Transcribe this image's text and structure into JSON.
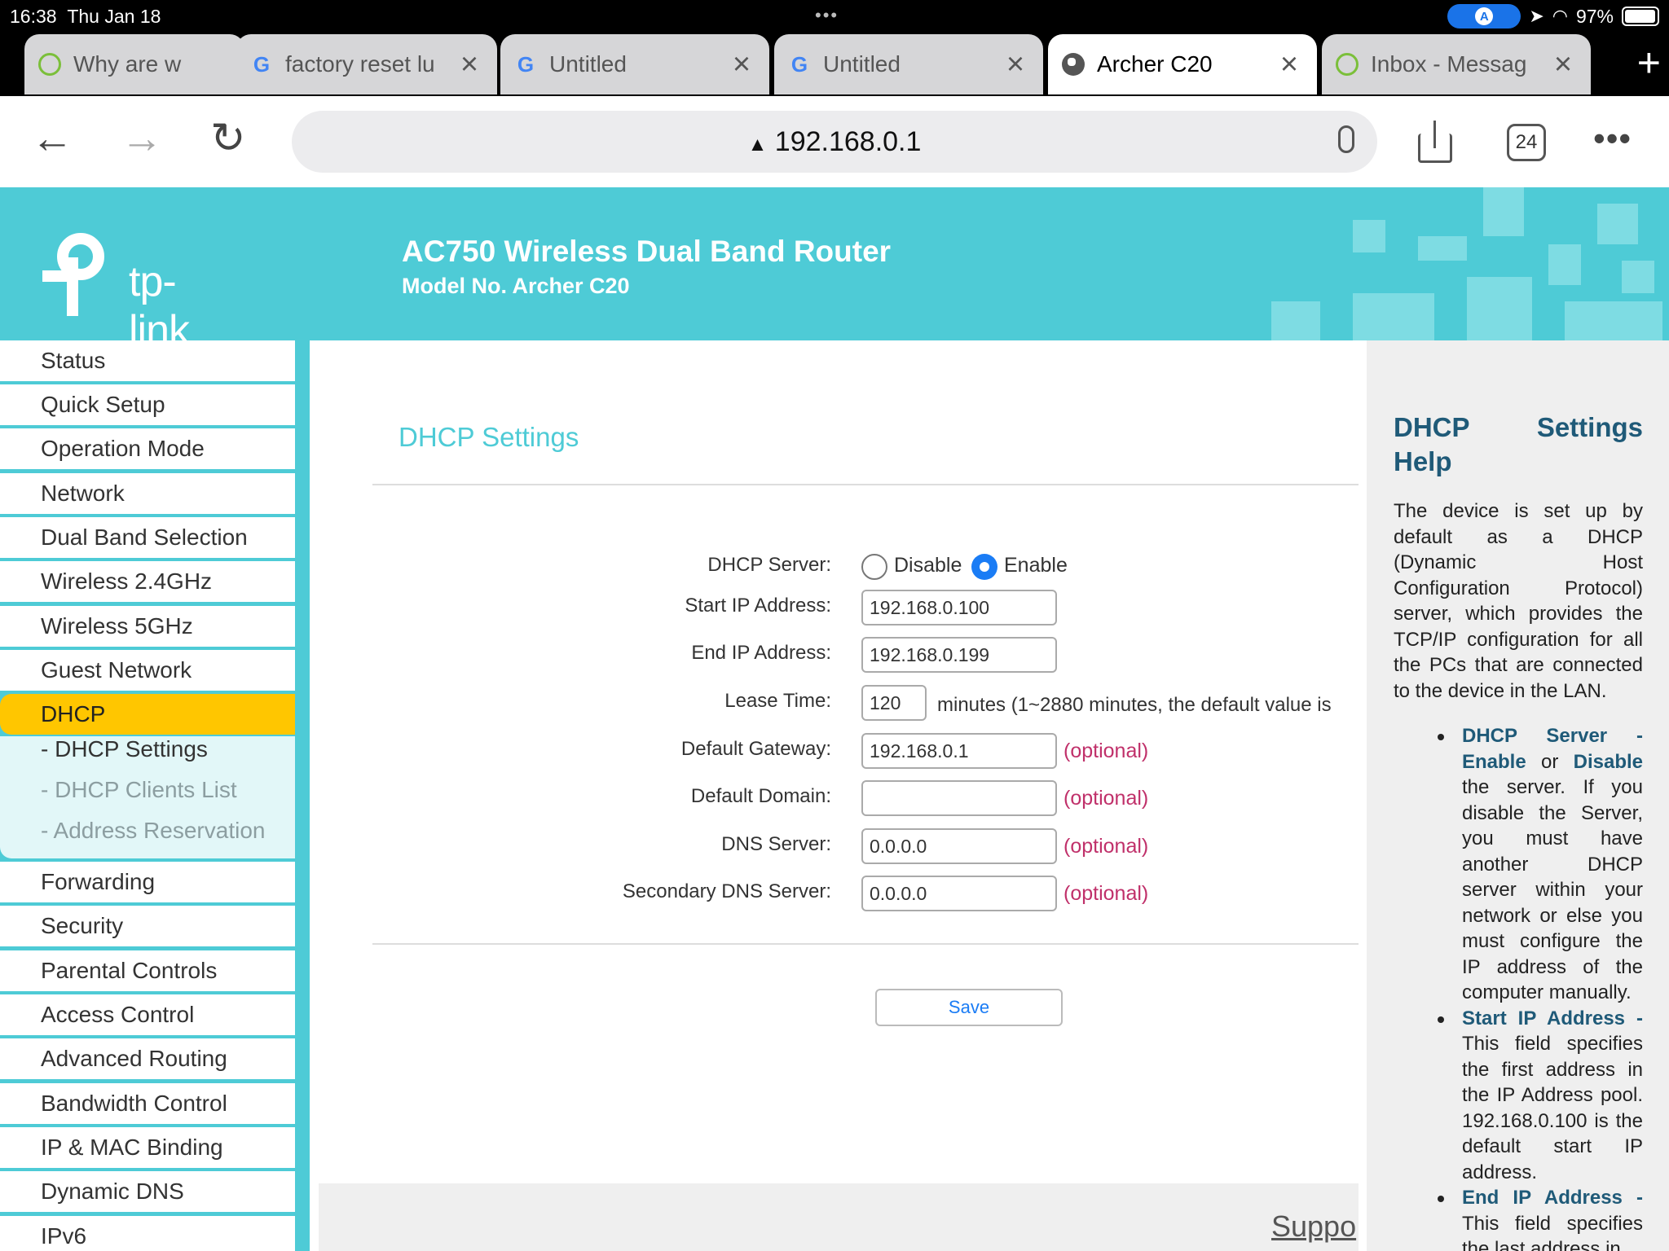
{
  "status_bar": {
    "time": "16:38",
    "date": "Thu Jan 18",
    "battery": "97%",
    "battery_level": 0.97
  },
  "tabs": [
    {
      "title": "Why are w",
      "icon": "ring-icon"
    },
    {
      "title": "factory reset lu",
      "icon": "google-icon"
    },
    {
      "title": "Untitled",
      "icon": "google-icon"
    },
    {
      "title": "Untitled",
      "icon": "google-icon"
    },
    {
      "title": "Archer C20",
      "icon": "globe-icon",
      "active": true
    },
    {
      "title": "Inbox - Messag",
      "icon": "ring-icon"
    }
  ],
  "toolbar": {
    "url": "192.168.0.1",
    "tab_count": "24"
  },
  "router": {
    "logo_text": "tp-link",
    "title": "AC750 Wireless Dual Band Router",
    "model": "Model No. Archer C20"
  },
  "sidebar": {
    "items": [
      "Status",
      "Quick Setup",
      "Operation Mode",
      "Network",
      "Dual Band Selection",
      "Wireless 2.4GHz",
      "Wireless 5GHz",
      "Guest Network",
      "DHCP",
      "Forwarding",
      "Security",
      "Parental Controls",
      "Access Control",
      "Advanced Routing",
      "Bandwidth Control",
      "IP & MAC Binding",
      "Dynamic DNS",
      "IPv6"
    ],
    "active": "DHCP",
    "subitems": [
      "- DHCP Settings",
      "- DHCP Clients List",
      "- Address Reservation"
    ]
  },
  "main": {
    "title": "DHCP Settings",
    "labels": {
      "dhcp_server": "DHCP Server:",
      "start_ip": "Start IP Address:",
      "end_ip": "End IP Address:",
      "lease_time": "Lease Time:",
      "gateway": "Default Gateway:",
      "domain": "Default Domain:",
      "dns": "DNS Server:",
      "dns2": "Secondary DNS Server:"
    },
    "radio": {
      "disable": "Disable",
      "enable": "Enable",
      "selected": "Enable"
    },
    "values": {
      "start_ip": "192.168.0.100",
      "end_ip": "192.168.0.199",
      "lease_time": "120",
      "gateway": "192.168.0.1",
      "domain": "",
      "dns": "0.0.0.0",
      "dns2": "0.0.0.0"
    },
    "lease_hint": "minutes (1~2880 minutes, the default value is",
    "optional": "(optional)",
    "save": "Save",
    "support": "Suppo"
  },
  "help": {
    "title_1": "DHCP",
    "title_2": "Settings",
    "title_3": "Help",
    "intro": "The device is set up by default as a DHCP (Dynamic Host Configuration Protocol) server, which provides the TCP/IP configuration for all the PCs that are connected to the device in the LAN.",
    "items": [
      {
        "head": "DHCP Server - Enable",
        "mid": " or ",
        "head2": "Disable",
        "text": " the server. If you disable the Server, you must have another DHCP server within your network or else you must configure the IP address of the computer manually."
      },
      {
        "head": "Start IP Address -",
        "text": " This field specifies the first address in the IP Address pool. 192.168.0.100 is the default start IP address."
      },
      {
        "head": "End IP Address -",
        "text": " This field specifies the last address in"
      }
    ]
  },
  "colors": {
    "brand": "#4ecbd6",
    "active_menu": "#ffc600",
    "help_title": "#1f5a78",
    "optional": "#c0306a",
    "link": "#1a7cf5"
  }
}
